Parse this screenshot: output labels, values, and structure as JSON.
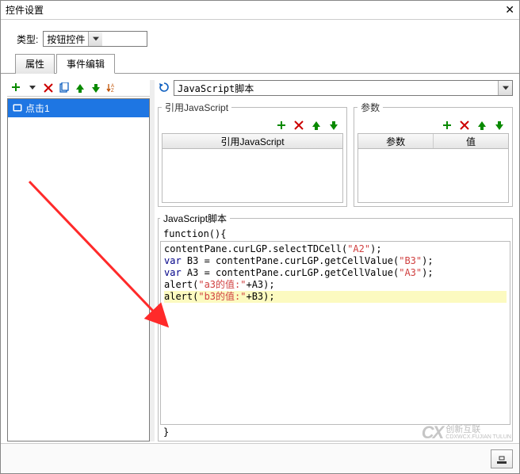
{
  "window": {
    "title": "控件设置"
  },
  "type": {
    "label": "类型:",
    "value": "按钮控件"
  },
  "tabs": {
    "attr": "属性",
    "event": "事件编辑"
  },
  "left": {
    "events": [
      {
        "label": "点击1"
      }
    ]
  },
  "right": {
    "script_type": "JavaScript脚本",
    "js_section": {
      "legend": "引用JavaScript",
      "column": "引用JavaScript"
    },
    "param_section": {
      "legend": "参数",
      "col1": "参数",
      "col2": "值"
    },
    "scriptbox": {
      "legend": "JavaScript脚本",
      "funcline_open": "function(){",
      "funcline_close": "}"
    },
    "code": {
      "lines": [
        {
          "parts": [
            {
              "t": "contentPane.curLGP.selectTDCell("
            },
            {
              "t": "\"A2\"",
              "c": "str"
            },
            {
              "t": ");"
            }
          ]
        },
        {
          "parts": [
            {
              "t": "var",
              "c": "kw"
            },
            {
              "t": " B3 = contentPane.curLGP.getCellValue("
            },
            {
              "t": "\"B3\"",
              "c": "str"
            },
            {
              "t": ");"
            }
          ]
        },
        {
          "parts": [
            {
              "t": "var",
              "c": "kw"
            },
            {
              "t": " A3 = contentPane.curLGP.getCellValue("
            },
            {
              "t": "\"A3\"",
              "c": "str"
            },
            {
              "t": ");"
            }
          ]
        },
        {
          "parts": [
            {
              "t": "alert("
            },
            {
              "t": "\"a3的值:\"",
              "c": "str"
            },
            {
              "t": "+A3);"
            }
          ]
        },
        {
          "hl": true,
          "parts": [
            {
              "t": "alert("
            },
            {
              "t": "\"b3的值:\"",
              "c": "str"
            },
            {
              "t": "+B3);"
            }
          ]
        }
      ]
    }
  },
  "watermark": {
    "brand": "CX",
    "text1": "创新互联",
    "text2": "CDXWCX.FUJIAN TULUN"
  }
}
